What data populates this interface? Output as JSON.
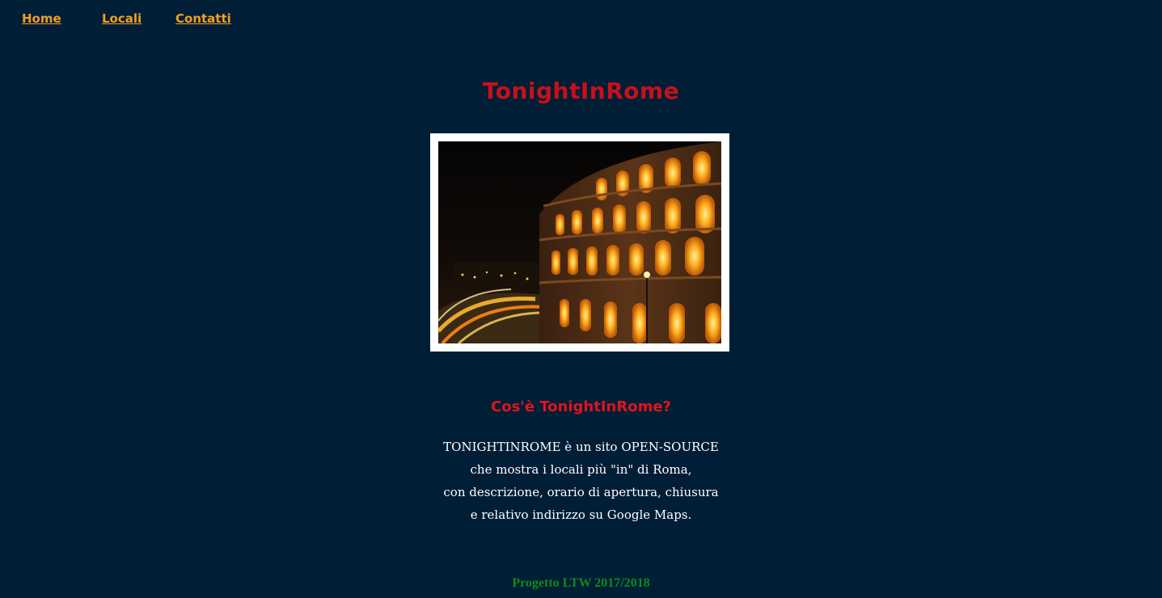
{
  "nav": {
    "items": [
      {
        "label": "Home"
      },
      {
        "label": "Locali"
      },
      {
        "label": "Contatti"
      }
    ]
  },
  "header": {
    "title": "TonightInRome"
  },
  "hero": {
    "image_subject": "Colosseum at night with light trails"
  },
  "about": {
    "heading": "Cos'è TonightInRome?",
    "lines": [
      "TONIGHTINROME è un sito OPEN-SOURCE",
      "che mostra i locali più \"in\" di Roma,",
      "con descrizione, orario di apertura, chiusura",
      "e relativo indirizzo su Google Maps."
    ]
  },
  "footer": {
    "text": "Progetto LTW 2017/2018"
  },
  "colors": {
    "background": "#001e36",
    "nav_link": "#f0a020",
    "title": "#c8101a",
    "heading": "#e0141c",
    "body_text": "#ffffff",
    "footer": "#0e8a1a"
  }
}
